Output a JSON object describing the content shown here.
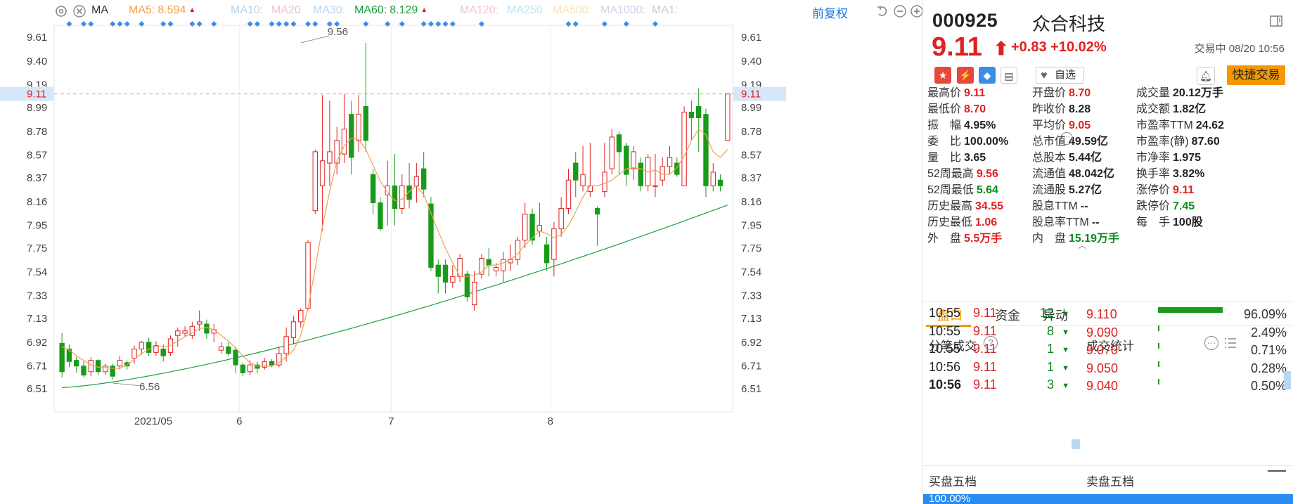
{
  "toolbar": {
    "ma_label": "MA",
    "ma_items": [
      {
        "label": "MA5:",
        "value": "8.594",
        "color": "#f0a050",
        "arrow": "up"
      },
      {
        "label": "MA10:",
        "value": "",
        "color": "#b8d4ec",
        "arrow": ""
      },
      {
        "label": "MA20",
        "value": "",
        "color": "#f3c0d8",
        "arrow": ""
      },
      {
        "label": "MA30:",
        "value": "",
        "color": "#b8d4ec",
        "arrow": ""
      },
      {
        "label": "MA60:",
        "value": "8.129",
        "color": "#1ea03c",
        "arrow": "up"
      },
      {
        "label": "MA120:",
        "value": "",
        "color": "#f3c0d8",
        "arrow": ""
      },
      {
        "label": "MA250",
        "value": "",
        "color": "#bde3f5",
        "arrow": ""
      },
      {
        "label": "MA500:",
        "value": "",
        "color": "#f7e2b5",
        "arrow": ""
      },
      {
        "label": "MA1000:",
        "value": "",
        "color": "#d8cdea",
        "arrow": ""
      },
      {
        "label": "MA1:",
        "value": "",
        "color": "#cccccc",
        "arrow": ""
      }
    ],
    "fq_label": "前复权",
    "icons": [
      "settings-icon",
      "close-icon",
      "undo-icon",
      "zoom-out-icon",
      "zoom-in-icon"
    ]
  },
  "chart_data": {
    "type": "candlestick",
    "y_ticks": [
      "9.61",
      "9.40",
      "9.19",
      "8.99",
      "8.78",
      "8.57",
      "8.37",
      "8.16",
      "7.95",
      "7.75",
      "7.54",
      "7.33",
      "7.13",
      "6.92",
      "6.71",
      "6.51"
    ],
    "ylim": [
      6.51,
      9.61
    ],
    "x_labels": [
      {
        "label": "2021/05",
        "index": 11
      },
      {
        "label": "6",
        "index": 25
      },
      {
        "label": "7",
        "index": 46
      },
      {
        "label": "8",
        "index": 68
      }
    ],
    "current_price": "9.11",
    "annotations": [
      {
        "text": "9.56",
        "index": 33,
        "value": 9.56
      },
      {
        "text": "6.56",
        "index": 7,
        "value": 6.56
      }
    ],
    "marker_indices": [
      1,
      3,
      4,
      7,
      8,
      9,
      11,
      14,
      15,
      18,
      19,
      21,
      26,
      27,
      29,
      30,
      31,
      32,
      34,
      35,
      37,
      38,
      42,
      45,
      47,
      50,
      51,
      52,
      53,
      54,
      58,
      70,
      71,
      75,
      78,
      82
    ],
    "candles": [
      [
        6.91,
        6.66,
        7.0,
        6.61
      ],
      [
        6.86,
        6.75,
        6.9,
        6.7
      ],
      [
        6.76,
        6.71,
        6.79,
        6.65
      ],
      [
        6.71,
        6.63,
        6.75,
        6.61
      ],
      [
        6.66,
        6.76,
        6.79,
        6.62
      ],
      [
        6.76,
        6.66,
        6.77,
        6.63
      ],
      [
        6.66,
        6.71,
        6.73,
        6.63
      ],
      [
        6.71,
        6.62,
        6.73,
        6.59
      ],
      [
        6.71,
        6.76,
        6.8,
        6.68
      ],
      [
        6.74,
        6.71,
        6.76,
        6.68
      ],
      [
        6.78,
        6.86,
        6.89,
        6.73
      ],
      [
        6.86,
        6.92,
        6.93,
        6.81
      ],
      [
        6.92,
        6.83,
        6.96,
        6.8
      ],
      [
        6.83,
        6.89,
        6.93,
        6.8
      ],
      [
        6.86,
        6.8,
        6.9,
        6.75
      ],
      [
        6.83,
        6.95,
        6.98,
        6.8
      ],
      [
        6.98,
        7.02,
        7.05,
        6.88
      ],
      [
        7.0,
        7.02,
        7.06,
        6.97
      ],
      [
        6.98,
        7.06,
        7.1,
        6.95
      ],
      [
        7.08,
        7.1,
        7.2,
        7.02
      ],
      [
        7.08,
        7.0,
        7.12,
        6.95
      ],
      [
        7.0,
        7.03,
        7.08,
        6.92
      ],
      [
        6.85,
        6.88,
        6.92,
        6.82
      ],
      [
        6.88,
        6.82,
        6.92,
        6.8
      ],
      [
        6.85,
        6.72,
        6.88,
        6.65
      ],
      [
        6.72,
        6.65,
        6.74,
        6.62
      ],
      [
        6.66,
        6.72,
        6.76,
        6.63
      ],
      [
        6.72,
        6.69,
        6.75,
        6.65
      ],
      [
        6.7,
        6.75,
        6.78,
        6.68
      ],
      [
        6.75,
        6.72,
        6.77,
        6.7
      ],
      [
        6.72,
        6.82,
        6.88,
        6.7
      ],
      [
        6.82,
        6.97,
        7.05,
        6.75
      ],
      [
        6.96,
        7.1,
        7.15,
        6.9
      ],
      [
        7.1,
        7.2,
        7.22,
        7.05
      ],
      [
        7.22,
        7.8,
        7.82,
        7.2
      ],
      [
        8.08,
        8.6,
        8.62,
        8.05
      ],
      [
        8.3,
        8.52,
        9.1,
        7.9
      ],
      [
        8.5,
        8.6,
        9.05,
        8.3
      ],
      [
        8.5,
        8.7,
        8.82,
        8.4
      ],
      [
        8.58,
        8.8,
        9.11,
        8.5
      ],
      [
        8.93,
        8.55,
        9.05,
        8.4
      ],
      [
        8.7,
        8.93,
        9.1,
        8.6
      ],
      [
        9.0,
        8.7,
        9.56,
        8.6
      ],
      [
        8.4,
        8.15,
        8.45,
        8.05
      ],
      [
        8.15,
        7.92,
        8.2,
        7.9
      ],
      [
        8.22,
        8.3,
        8.52,
        7.95
      ],
      [
        8.3,
        8.1,
        8.58,
        7.95
      ],
      [
        8.1,
        8.3,
        8.4,
        8.05
      ],
      [
        8.3,
        8.18,
        8.5,
        8.1
      ],
      [
        8.3,
        8.38,
        8.5,
        8.15
      ],
      [
        8.45,
        8.27,
        8.6,
        8.2
      ],
      [
        8.14,
        7.58,
        8.2,
        7.55
      ],
      [
        7.6,
        7.5,
        7.65,
        7.35
      ],
      [
        7.6,
        7.45,
        7.65,
        7.35
      ],
      [
        7.45,
        7.5,
        7.6,
        7.4
      ],
      [
        7.5,
        7.66,
        7.7,
        7.45
      ],
      [
        7.52,
        7.32,
        7.55,
        7.28
      ],
      [
        7.25,
        7.45,
        7.55,
        7.2
      ],
      [
        7.52,
        7.66,
        7.7,
        7.48
      ],
      [
        7.65,
        7.6,
        7.75,
        7.5
      ],
      [
        7.55,
        7.58,
        7.62,
        7.5
      ],
      [
        7.55,
        7.65,
        7.72,
        7.45
      ],
      [
        7.62,
        7.65,
        7.78,
        7.55
      ],
      [
        7.65,
        7.82,
        7.85,
        7.6
      ],
      [
        7.82,
        8.05,
        8.15,
        7.75
      ],
      [
        8.05,
        7.82,
        8.1,
        7.78
      ],
      [
        7.9,
        7.95,
        8.15,
        7.85
      ],
      [
        7.78,
        7.62,
        7.85,
        7.55
      ],
      [
        7.65,
        7.92,
        7.98,
        7.5
      ],
      [
        7.92,
        8.1,
        8.2,
        7.85
      ],
      [
        8.1,
        8.35,
        8.45,
        8.05
      ],
      [
        8.5,
        8.35,
        8.6,
        8.2
      ],
      [
        8.3,
        8.4,
        8.65,
        8.25
      ],
      [
        8.25,
        8.3,
        8.68,
        8.2
      ],
      [
        8.1,
        8.05,
        8.12,
        7.77
      ],
      [
        8.25,
        8.42,
        8.68,
        8.2
      ],
      [
        8.45,
        8.73,
        8.8,
        8.4
      ],
      [
        8.75,
        8.6,
        8.78,
        8.4
      ],
      [
        8.65,
        8.4,
        8.68,
        8.3
      ],
      [
        8.45,
        8.6,
        8.65,
        8.35
      ],
      [
        8.5,
        8.3,
        8.55,
        8.25
      ],
      [
        8.3,
        8.55,
        8.58,
        8.25
      ],
      [
        8.3,
        8.3,
        8.58,
        8.2
      ],
      [
        8.35,
        8.47,
        8.55,
        8.3
      ],
      [
        8.47,
        8.55,
        8.65,
        8.4
      ],
      [
        8.5,
        8.4,
        8.55,
        8.38
      ],
      [
        8.3,
        8.95,
        9.0,
        8.3
      ],
      [
        8.95,
        8.9,
        9.05,
        8.7
      ],
      [
        9.0,
        8.9,
        9.16,
        8.6
      ],
      [
        8.93,
        8.3,
        8.98,
        8.2
      ],
      [
        8.3,
        8.42,
        8.5,
        8.25
      ],
      [
        8.35,
        8.3,
        8.4,
        8.25
      ],
      [
        8.7,
        9.11,
        9.11,
        8.7
      ]
    ],
    "ma5": [
      6.88,
      6.85,
      6.8,
      6.76,
      6.72,
      6.7,
      6.7,
      6.69,
      6.69,
      6.72,
      6.77,
      6.82,
      6.86,
      6.88,
      6.88,
      6.89,
      6.93,
      6.97,
      7.0,
      7.04,
      7.05,
      7.03,
      6.98,
      6.93,
      6.87,
      6.8,
      6.74,
      6.71,
      6.71,
      6.71,
      6.74,
      6.79,
      6.85,
      6.98,
      7.22,
      7.57,
      7.94,
      8.25,
      8.52,
      8.65,
      8.72,
      8.71,
      8.62,
      8.48,
      8.34,
      8.24,
      8.17,
      8.18,
      8.25,
      8.3,
      8.22,
      8.06,
      7.9,
      7.75,
      7.62,
      7.5,
      7.5,
      7.51,
      7.54,
      7.6,
      7.6,
      7.62,
      7.65,
      7.7,
      7.78,
      7.84,
      7.9,
      7.88,
      7.84,
      7.87,
      7.95,
      8.07,
      8.2,
      8.3,
      8.3,
      8.32,
      8.35,
      8.4,
      8.45,
      8.46,
      8.45,
      8.42,
      8.44,
      8.4,
      8.4,
      8.46,
      8.56,
      8.7,
      8.8,
      8.75,
      8.6,
      8.55,
      8.62
    ]
  },
  "panel": {
    "code": "000925",
    "name": "众合科技",
    "price": "9.11",
    "arrow": "⬆",
    "change": "+0.83",
    "change_pct": "+10.02%",
    "status": "交易中 08/20 10:56",
    "watch_label": "自选",
    "trade_label": "快捷交易",
    "quotes": [
      {
        "k": "最高价",
        "v": "9.11",
        "c": "red"
      },
      {
        "k": "开盘价",
        "v": "8.70",
        "c": "red"
      },
      {
        "k": "成交量",
        "v": "20.12万手",
        "c": "dark"
      },
      {
        "k": "最低价",
        "v": "8.70",
        "c": "red"
      },
      {
        "k": "昨收价",
        "v": "8.28",
        "c": "dark"
      },
      {
        "k": "成交额",
        "v": "1.82亿",
        "c": "dark"
      },
      {
        "k": "振　幅",
        "v": "4.95%",
        "c": "dark"
      },
      {
        "k": "平均价",
        "v": "9.05",
        "c": "red"
      },
      {
        "k": "市盈率TTM",
        "v": "24.62",
        "c": "dark"
      },
      {
        "k": "委　比",
        "v": "100.00%",
        "c": "dark"
      },
      {
        "k": "总市值",
        "v": "49.59亿",
        "c": "dark"
      },
      {
        "k": "市盈率(静)",
        "v": "87.60",
        "c": "dark"
      },
      {
        "k": "量　比",
        "v": "3.65",
        "c": "dark"
      },
      {
        "k": "总股本",
        "v": "5.44亿",
        "c": "dark"
      },
      {
        "k": "市净率",
        "v": "1.975",
        "c": "dark"
      },
      {
        "k": "52周最高",
        "v": "9.56",
        "c": "red"
      },
      {
        "k": "流通值",
        "v": "48.042亿",
        "c": "dark"
      },
      {
        "k": "换手率",
        "v": "3.82%",
        "c": "dark"
      },
      {
        "k": "52周最低",
        "v": "5.64",
        "c": "green"
      },
      {
        "k": "流通股",
        "v": "5.27亿",
        "c": "dark"
      },
      {
        "k": "涨停价",
        "v": "9.11",
        "c": "red"
      },
      {
        "k": "历史最高",
        "v": "34.55",
        "c": "red"
      },
      {
        "k": "股息TTM",
        "v": "--",
        "c": "dark"
      },
      {
        "k": "跌停价",
        "v": "7.45",
        "c": "green"
      },
      {
        "k": "历史最低",
        "v": "1.06",
        "c": "red"
      },
      {
        "k": "股息率TTM",
        "v": "--",
        "c": "dark"
      },
      {
        "k": "每　手",
        "v": "100股",
        "c": "dark"
      },
      {
        "k": "外　盘",
        "v": "5.5万手",
        "c": "red"
      },
      {
        "k": "内　盘",
        "v": "15.19万手",
        "c": "green"
      }
    ],
    "tabs": [
      "盘口",
      "资金",
      "异动"
    ],
    "trades_title": "分笔成交",
    "stats_title": "成交统计",
    "trades": [
      {
        "time": "10:55",
        "price": "9.11",
        "vol": "12"
      },
      {
        "time": "10:55",
        "price": "9.11",
        "vol": "8"
      },
      {
        "time": "10:55",
        "price": "9.11",
        "vol": "1"
      },
      {
        "time": "10:56",
        "price": "9.11",
        "vol": "1"
      },
      {
        "time": "10:56",
        "price": "9.11",
        "vol": "3"
      }
    ],
    "stats": [
      {
        "price": "9.110",
        "pct": "96.09%",
        "share": 0.9609
      },
      {
        "price": "9.090",
        "pct": "2.49%",
        "share": 0.0249
      },
      {
        "price": "9.070",
        "pct": "0.71%",
        "share": 0.0071
      },
      {
        "price": "9.050",
        "pct": "0.28%",
        "share": 0.0028
      },
      {
        "price": "9.040",
        "pct": "0.50%",
        "share": 0.005
      }
    ],
    "buy5_title": "买盘五档",
    "sell5_title": "卖盘五档",
    "bottom_text": "100.00%"
  }
}
